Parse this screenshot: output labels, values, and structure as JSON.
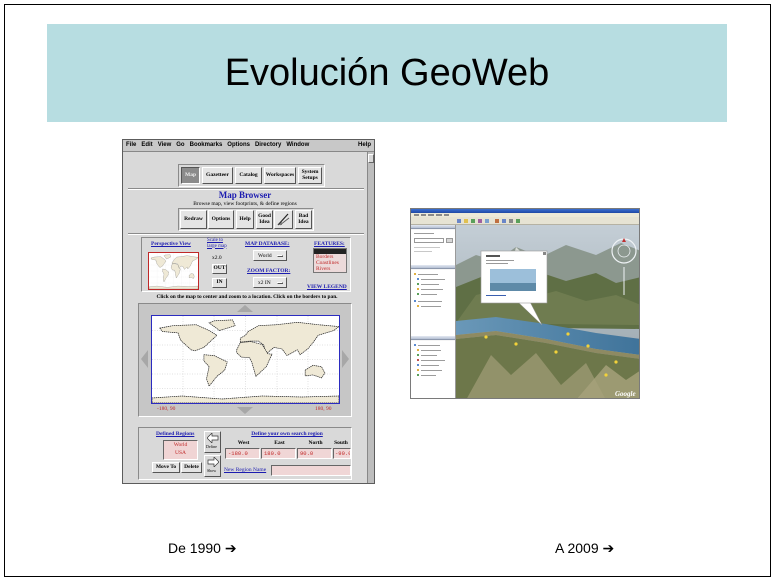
{
  "slide": {
    "title": "Evolución GeoWeb",
    "caption_left": "De 1990 ➔",
    "caption_right": "A 2009 ➔",
    "colors": {
      "title_bg": "#b7dde1",
      "frame": "#000000"
    }
  },
  "map_browser": {
    "menu": [
      "File",
      "Edit",
      "View",
      "Go",
      "Bookmarks",
      "Options",
      "Directory",
      "Window"
    ],
    "menu_help": "Help",
    "tabs": {
      "map": "Map",
      "gazetteer": "Gazetteer",
      "catalog": "Catalog",
      "workspaces": "Workspaces",
      "system_setups": "System Setups"
    },
    "title": "Map Browser",
    "subtitle": "Browse map, view footprints, & define regions",
    "toolbar": {
      "redraw": "Redraw",
      "options": "Options",
      "help": "Help",
      "good_idea": "Good Idea",
      "bad_idea": "Bad Idea"
    },
    "perspective_view": "Perspective View",
    "scale_link": "Scale to large map",
    "scale_value": "x2.0",
    "out_button": "OUT",
    "in_button": "IN",
    "map_database": {
      "label": "MAP DATABASE:",
      "value": "World"
    },
    "zoom_factor": {
      "label": "ZOOM FACTOR:",
      "value": "x2 IN"
    },
    "features": {
      "label": "FEATURES:",
      "items": [
        "Borders",
        "Coastlines",
        "Rivers"
      ]
    },
    "view_legend": "VIEW LEGEND",
    "instruction": "Click on the map to center and zoom to a location. Click on the borders to pan.",
    "map_corner_left": "-180, 90",
    "map_corner_right": "180, 90",
    "defined_regions": {
      "label": "Defined Regions",
      "items": [
        "World",
        "USA"
      ],
      "move_to": "Move To",
      "delete": "Delete"
    },
    "define_button": "Define",
    "show_button": "Show",
    "search_region": {
      "title": "Define your own search region",
      "headers": [
        "West",
        "East",
        "North",
        "South"
      ],
      "values": [
        "-180.0",
        "180.0",
        "90.0",
        "-90.0"
      ]
    },
    "new_region_name": "New Region Name",
    "colors": {
      "link": "#1b1bb0",
      "region_text": "#c02828",
      "panel": "#d9d9d9"
    }
  },
  "google_earth": {
    "watermark": "Google",
    "colors": {
      "lake": "#4f83a8",
      "terrain": "#5f6f45",
      "sky": "#c4ced6"
    }
  }
}
